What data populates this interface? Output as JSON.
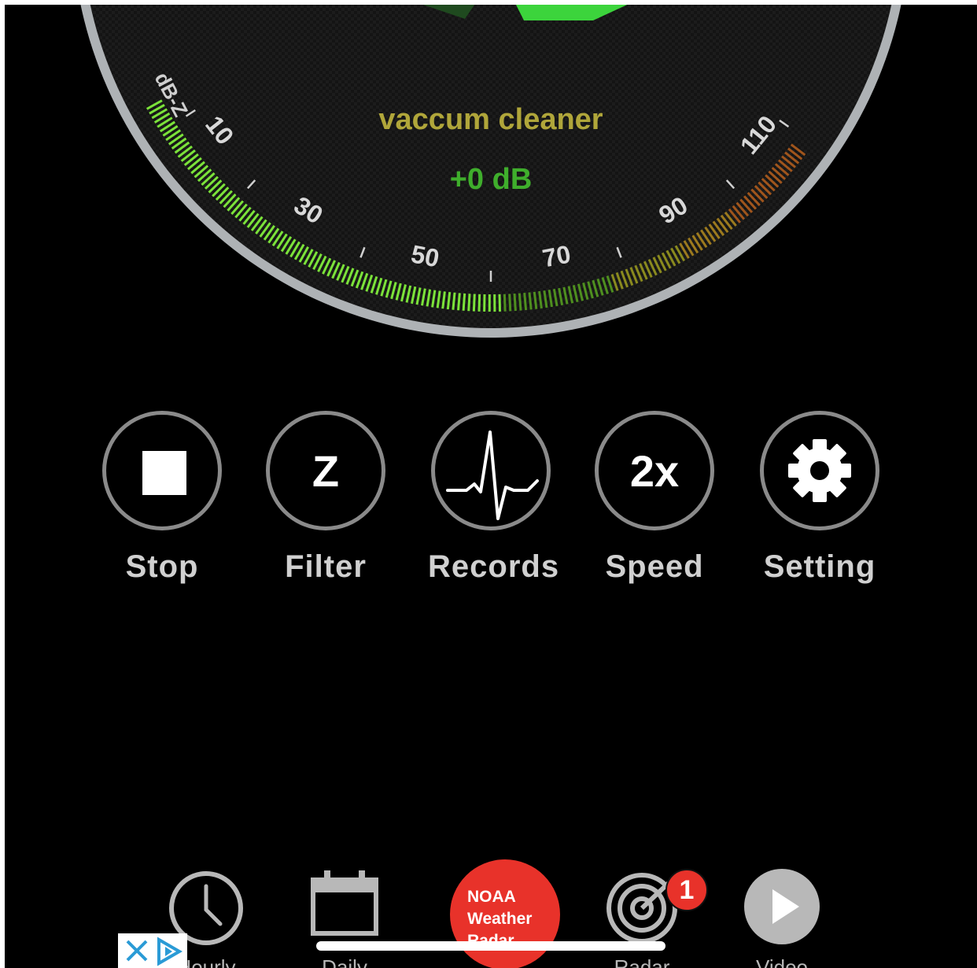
{
  "meter": {
    "weighting_label": "dB-Z",
    "ticks": [
      "10",
      "30",
      "50",
      "70",
      "90",
      "110"
    ],
    "source_label": "vaccum cleaner",
    "offset_label": "+0 dB",
    "colors": {
      "source": "#b0a63a",
      "offset": "#3fae2c",
      "rim": "#b8bcbf",
      "face": "#161616",
      "needle": "#3cd43c"
    }
  },
  "controls": {
    "stop": {
      "label": "Stop",
      "icon": "stop-icon"
    },
    "filter": {
      "label": "Filter",
      "glyph": "Z",
      "icon": "filter-icon"
    },
    "records": {
      "label": "Records",
      "icon": "waveform-icon"
    },
    "speed": {
      "label": "Speed",
      "glyph": "2x",
      "icon": "speed-icon"
    },
    "setting": {
      "label": "Setting",
      "icon": "gear-icon"
    }
  },
  "tabbar": {
    "hourly": {
      "label": "Hourly",
      "icon": "clock-icon"
    },
    "daily": {
      "label": "Daily",
      "icon": "calendar-icon"
    },
    "noaa": {
      "line1": "NOAA",
      "line2": "Weather",
      "line3": "Radar"
    },
    "radar": {
      "label": "Radar",
      "icon": "radar-icon",
      "badge": "1"
    },
    "video": {
      "label": "Video",
      "icon": "play-icon"
    }
  },
  "ad": {
    "icon": "ad-choices-icon"
  }
}
